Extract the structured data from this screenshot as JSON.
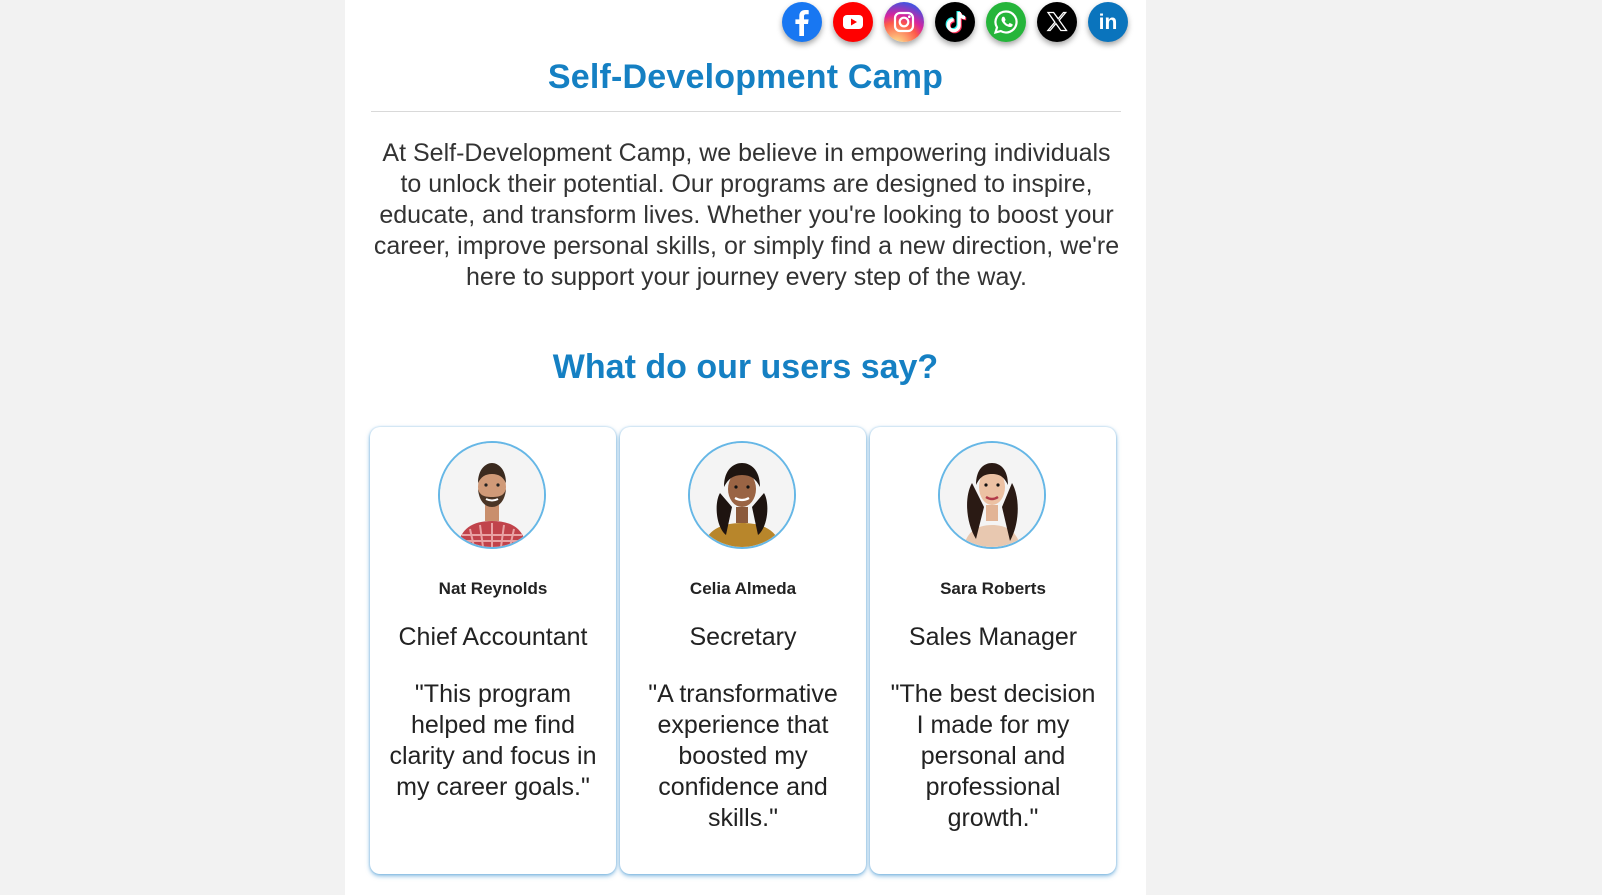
{
  "social": {
    "icons": [
      {
        "name": "facebook-icon",
        "color": "#1877f2"
      },
      {
        "name": "youtube-icon",
        "color": "#ff0000"
      },
      {
        "name": "instagram-icon",
        "color": "#e1306c"
      },
      {
        "name": "tiktok-icon",
        "color": "#000000"
      },
      {
        "name": "whatsapp-icon",
        "color": "#25d366"
      },
      {
        "name": "x-icon",
        "color": "#000000"
      },
      {
        "name": "linkedin-icon",
        "color": "#0a66c2"
      }
    ],
    "linkedin_text": "in"
  },
  "header": {
    "title": "Self-Development Camp"
  },
  "intro": {
    "text": "At Self-Development Camp, we believe in empowering individuals to unlock their potential. Our programs are designed to inspire, educate, and transform lives. Whether you're looking to boost your career, improve personal skills, or simply find a new direction, we're here to support your journey every step of the way."
  },
  "testimonials": {
    "heading": "What do our users say?",
    "items": [
      {
        "name": "Nat Reynolds",
        "role": "Chief Accountant",
        "quote": "\"This program helped me find clarity and focus in my career goals.\""
      },
      {
        "name": "Celia Almeda",
        "role": "Secretary",
        "quote": "\"A transformative experience that boosted my confidence and skills.\""
      },
      {
        "name": "Sara Roberts",
        "role": "Sales Manager",
        "quote": "\"The best decision I made for my personal and professional growth.\""
      }
    ]
  },
  "colors": {
    "accent": "#1580c3",
    "avatar_border": "#66b7e6"
  }
}
